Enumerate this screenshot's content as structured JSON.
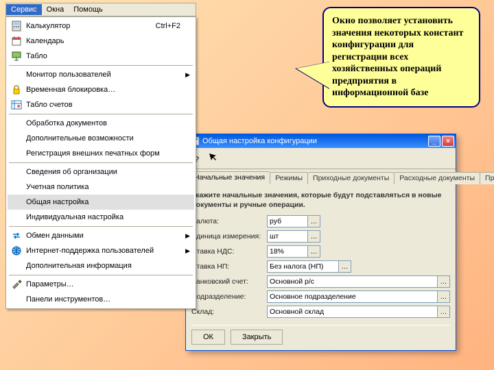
{
  "callout": {
    "text": "Окно позволяет установить значения некоторых констант конфигурации для регистрации всех хозяйственных операций предприятия в информационной базе"
  },
  "menubar": {
    "items": [
      "Сервис",
      "Окна",
      "Помощь"
    ],
    "open_index": 0
  },
  "menu": [
    {
      "label": "Калькулятор",
      "icon": "calc",
      "shortcut": "Ctrl+F2"
    },
    {
      "label": "Календарь",
      "icon": "calendar"
    },
    {
      "label": "Табло",
      "icon": "board"
    },
    {
      "sep": true
    },
    {
      "label": "Монитор пользователей",
      "icon": "blank",
      "submenu": true
    },
    {
      "label": "Временная блокировка…",
      "icon": "lock"
    },
    {
      "label": "Табло счетов",
      "icon": "accounts"
    },
    {
      "sep": true
    },
    {
      "label": "Обработка документов",
      "icon": "blank"
    },
    {
      "label": "Дополнительные возможности",
      "icon": "blank"
    },
    {
      "label": "Регистрация внешних печатных форм",
      "icon": "blank"
    },
    {
      "sep": true
    },
    {
      "label": "Сведения об организации",
      "icon": "blank"
    },
    {
      "label": "Учетная политика",
      "icon": "blank"
    },
    {
      "label": "Общая настройка",
      "icon": "blank",
      "selected": true
    },
    {
      "label": "Индивидуальная настройка",
      "icon": "blank"
    },
    {
      "sep": true
    },
    {
      "label": "Обмен данными",
      "icon": "exchange",
      "submenu": true
    },
    {
      "label": "Интернет-поддержка пользователей",
      "icon": "internet",
      "submenu": true
    },
    {
      "label": "Дополнительная информация",
      "icon": "blank"
    },
    {
      "sep": true
    },
    {
      "label": "Параметры…",
      "icon": "params"
    },
    {
      "label": "Панели инструментов…",
      "icon": "blank"
    }
  ],
  "dialog": {
    "title": "Общая настройка конфигурации",
    "tabs": [
      "Начальные значения",
      "Режимы",
      "Приходные документы",
      "Расходные документы",
      "Прочее"
    ],
    "active_tab": 0,
    "hint": "Укажите начальные значения, которые будут подставляться в новые документы и ручные операции.",
    "rows": {
      "currency_label": "Валюта:",
      "currency_value": "руб",
      "unit_label": "Единица измерения:",
      "unit_value": "шт",
      "vat_label": "Ставка НДС:",
      "vat_value": "18%",
      "np_label": "Ставка НП:",
      "np_value": "Без налога (НП)",
      "account_label": "Банковский счет:",
      "account_value": "Основной р/с",
      "dept_label": "Подразделение:",
      "dept_value": "Основное подразделение",
      "wh_label": "Склад:",
      "wh_value": "Основной склад"
    },
    "buttons": {
      "ok": "ОК",
      "close": "Закрыть"
    }
  }
}
